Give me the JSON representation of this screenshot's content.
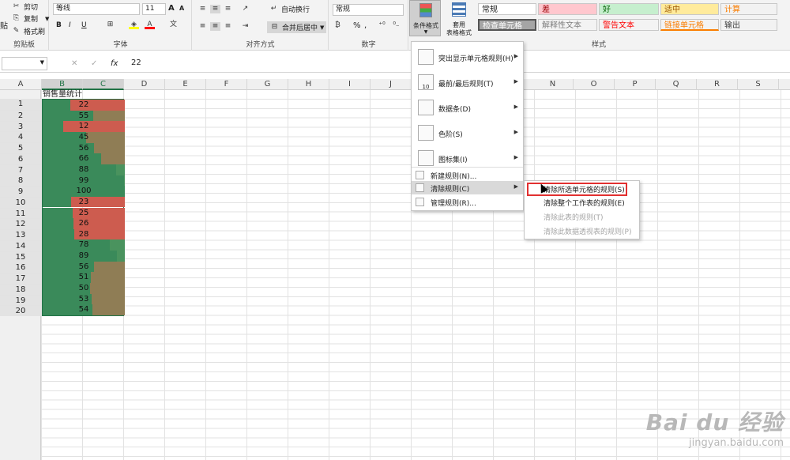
{
  "ribbon": {
    "clipboard": {
      "cut": "剪切",
      "copy": "复制",
      "format_painter": "格式刷",
      "paste_partial": "贴",
      "group_label": "剪贴板"
    },
    "font": {
      "font_name": "等线",
      "font_size": "11",
      "group_label": "字体",
      "bold": "B",
      "italic": "I",
      "underline": "U",
      "grow": "A",
      "shrink": "A"
    },
    "alignment": {
      "wrap": "自动换行",
      "merge": "合并后居中",
      "group_label": "对齐方式"
    },
    "number": {
      "format": "常规",
      "percent": "%",
      "comma": ",",
      "group_label": "数字"
    },
    "styles": {
      "cond_format": "条件格式",
      "table_format_1": "套用",
      "table_format_2": "表格格式",
      "cells": [
        {
          "label": "常规",
          "bg": "#ffffff",
          "color": "#222222"
        },
        {
          "label": "差",
          "bg": "#ffc7ce",
          "color": "#9c0006"
        },
        {
          "label": "好",
          "bg": "#c6efce",
          "color": "#006100"
        },
        {
          "label": "适中",
          "bg": "#ffeb9c",
          "color": "#9c5700"
        },
        {
          "label": "计算",
          "bg": "#f2f2f2",
          "color": "#fa7d00"
        },
        {
          "label": "检查单元格",
          "bg": "#a5a5a5",
          "color": "#ffffff"
        },
        {
          "label": "解释性文本",
          "bg": "#f3f3f3",
          "color": "#7f7f7f"
        },
        {
          "label": "警告文本",
          "bg": "#f3f3f3",
          "color": "#ff0000"
        },
        {
          "label": "链接单元格",
          "bg": "#f3f3f3",
          "color": "#fa7d00"
        },
        {
          "label": "输出",
          "bg": "#f2f2f2",
          "color": "#3f3f3f"
        }
      ],
      "group_label": "样式"
    }
  },
  "formula_bar": {
    "value": "22",
    "fx": "fx",
    "cancel": "✕",
    "enter": "✓"
  },
  "columns": [
    "A",
    "B",
    "C",
    "D",
    "E",
    "F",
    "G",
    "H",
    "I",
    "J",
    "N",
    "O",
    "P",
    "Q",
    "R",
    "S"
  ],
  "sheet": {
    "header": "销售量统计",
    "values": [
      22,
      55,
      12,
      45,
      56,
      66,
      88,
      99,
      100,
      23,
      25,
      26,
      28,
      78,
      89,
      56,
      51,
      50,
      53,
      54
    ],
    "rows": [
      1,
      2,
      3,
      4,
      5,
      6,
      7,
      8,
      9,
      10,
      11,
      12,
      13,
      14,
      15,
      16,
      17,
      18,
      19,
      20
    ],
    "bar_color": "#3a8a5a",
    "bg_low": "#cd5c4f",
    "bg_mid": "#8f7d55",
    "bg_high": "#4a935e"
  },
  "cf_menu": {
    "items": [
      {
        "label": "突出显示单元格规则(H)",
        "arrow": "▶"
      },
      {
        "label": "最前/最后规则(T)",
        "arrow": "▶",
        "icon_text": "10"
      },
      {
        "label": "数据条(D)",
        "arrow": "▶"
      },
      {
        "label": "色阶(S)",
        "arrow": "▶"
      },
      {
        "label": "图标集(I)",
        "arrow": "▶"
      },
      {
        "label": "新建规则(N)..."
      },
      {
        "label": "清除规则(C)",
        "arrow": "▶"
      },
      {
        "label": "管理规则(R)..."
      }
    ]
  },
  "clear_submenu": {
    "items": [
      {
        "label": "清除所选单元格的规则(S)",
        "enabled": true
      },
      {
        "label": "清除整个工作表的规则(E)",
        "enabled": true
      },
      {
        "label": "清除此表的规则(T)",
        "enabled": false
      },
      {
        "label": "清除此数据透视表的规则(P)",
        "enabled": false
      }
    ]
  },
  "watermark": {
    "brand": "Bai du 经验",
    "url": "jingyan.baidu.com"
  }
}
